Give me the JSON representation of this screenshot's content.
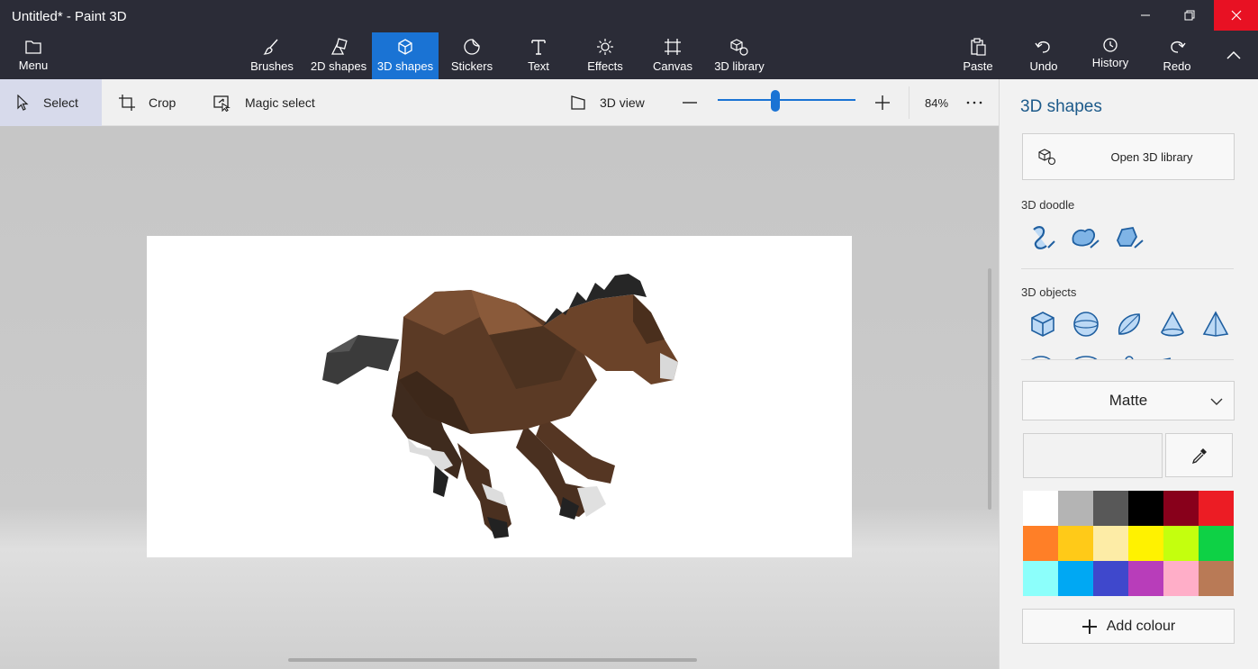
{
  "window": {
    "title": "Untitled* - Paint 3D"
  },
  "ribbon": {
    "menu": "Menu",
    "tabs": [
      {
        "key": "brushes",
        "label": "Brushes"
      },
      {
        "key": "2d-shapes",
        "label": "2D shapes"
      },
      {
        "key": "3d-shapes",
        "label": "3D shapes",
        "active": true
      },
      {
        "key": "stickers",
        "label": "Stickers"
      },
      {
        "key": "text",
        "label": "Text"
      },
      {
        "key": "effects",
        "label": "Effects"
      },
      {
        "key": "canvas",
        "label": "Canvas"
      },
      {
        "key": "3d-library",
        "label": "3D library"
      }
    ],
    "actions": {
      "paste": "Paste",
      "undo": "Undo",
      "history": "History",
      "redo": "Redo"
    }
  },
  "toolbar": {
    "select": "Select",
    "crop": "Crop",
    "magic_select": "Magic select",
    "view_3d": "3D view",
    "zoom_percent": "84%",
    "zoom_level": 0.42
  },
  "panel": {
    "title": "3D shapes",
    "open_library": "Open 3D library",
    "doodle_label": "3D doodle",
    "doodle_tools": [
      "sharp-edge-doodle-icon",
      "soft-edge-doodle-icon",
      "tube-doodle-icon"
    ],
    "objects_label": "3D objects",
    "objects": [
      "cube-icon",
      "sphere-icon",
      "capsule-icon",
      "cone-icon",
      "pyramid-icon"
    ],
    "material": "Matte",
    "add_colour": "Add colour",
    "palette": [
      "#ffffff",
      "#b4b4b4",
      "#585858",
      "#000000",
      "#88001b",
      "#ec1c24",
      "#ff7f27",
      "#ffca18",
      "#fdeca6",
      "#fff200",
      "#c4ff0e",
      "#0ed145",
      "#8cfffb",
      "#00a8f3",
      "#3f48cc",
      "#b83dba",
      "#ffaec8",
      "#b97a56"
    ],
    "accent": "#1a73d4"
  }
}
